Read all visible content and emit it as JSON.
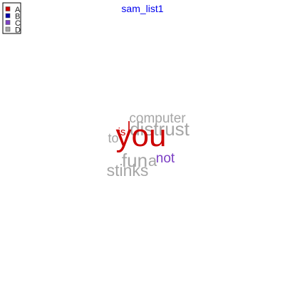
{
  "chart_data": {
    "type": "wordcloud",
    "title": "sam_list1",
    "title_color": "#0000ee",
    "legend": {
      "placement": "top-left",
      "entries": [
        {
          "label": "A",
          "color": "#cc0000"
        },
        {
          "label": "B",
          "color": "#0000aa"
        },
        {
          "label": "C",
          "color": "#7b3fc4"
        },
        {
          "label": "D",
          "color": "#a6a6a6"
        }
      ]
    },
    "words": [
      {
        "text": "you",
        "group": "A",
        "weight": 5
      },
      {
        "text": "distrust",
        "group": "D",
        "weight": 3
      },
      {
        "text": "computer",
        "group": "D",
        "weight": 2
      },
      {
        "text": "fun",
        "group": "D",
        "weight": 3
      },
      {
        "text": "stinks",
        "group": "D",
        "weight": 3
      },
      {
        "text": "is",
        "group": "A",
        "weight": 2
      },
      {
        "text": "I",
        "group": "A",
        "weight": 2
      },
      {
        "text": "to",
        "group": "D",
        "weight": 2
      },
      {
        "text": "a",
        "group": "D",
        "weight": 2
      },
      {
        "text": "not",
        "group": "C",
        "weight": 2
      }
    ]
  }
}
